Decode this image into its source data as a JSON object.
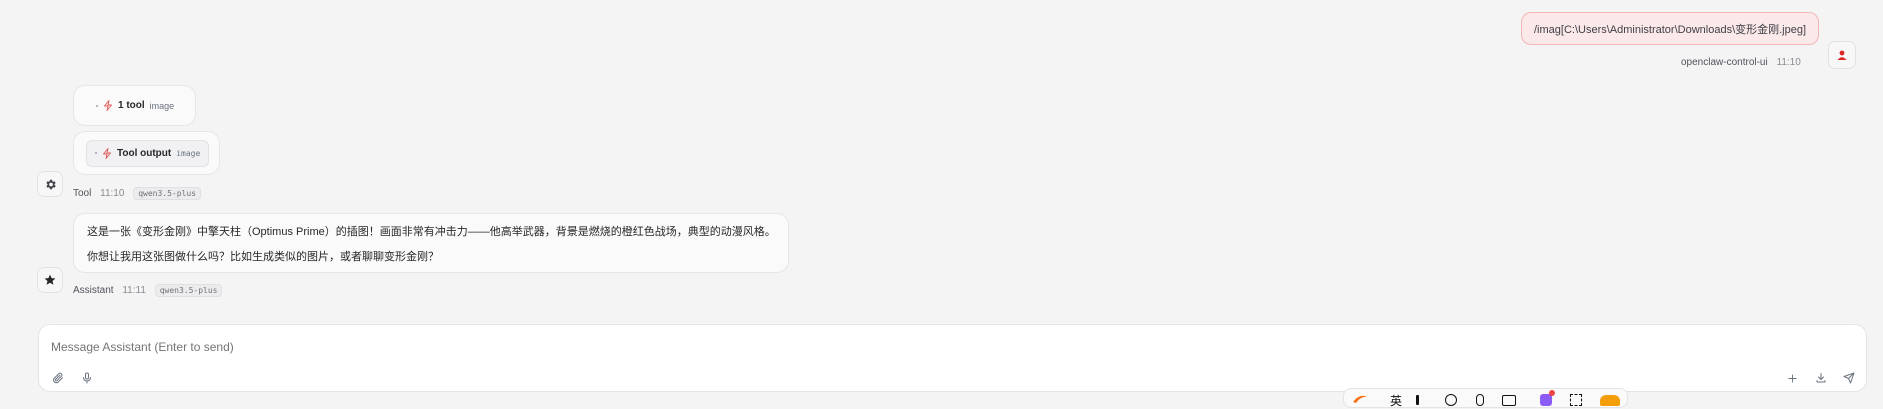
{
  "user_message": {
    "text": "/imag[C:\\Users\\Administrator\\Downloads\\变形金刚.jpeg]",
    "sender": "openclaw-control-ui",
    "time": "11:10"
  },
  "tool_block": {
    "call_summary": {
      "label": "1 tool",
      "tag": "image"
    },
    "output": {
      "label": "Tool output",
      "tag": "image"
    },
    "sender": "Tool",
    "time": "11:10",
    "model": "qwen3.5-plus"
  },
  "assistant_message": {
    "line1": "这是一张《变形金刚》中擎天柱（Optimus Prime）的插图！画面非常有冲击力——他高举武器，背景是燃烧的橙红色战场，典型的动漫风格。",
    "line2": "你想让我用这张图做什么吗？比如生成类似的图片，或者聊聊变形金刚？",
    "sender": "Assistant",
    "time": "11:11",
    "model": "qwen3.5-plus"
  },
  "composer": {
    "placeholder": "Message Assistant (Enter to send)"
  },
  "icons": {
    "user_avatar": "user-icon",
    "tool_avatar": "gear-icon",
    "assistant_avatar": "star-icon",
    "tool_item": "lightning-icon",
    "attach": "paperclip-icon",
    "mic": "microphone-icon",
    "add": "plus-icon",
    "download": "download-icon",
    "send": "send-icon"
  },
  "colors": {
    "background": "#f4f4f5",
    "user_bubble_bg": "#fbe9e9",
    "user_bubble_border": "#f2b4b4",
    "accent_red": "#dc2626"
  },
  "system_tray": {
    "lang_label": "英"
  }
}
